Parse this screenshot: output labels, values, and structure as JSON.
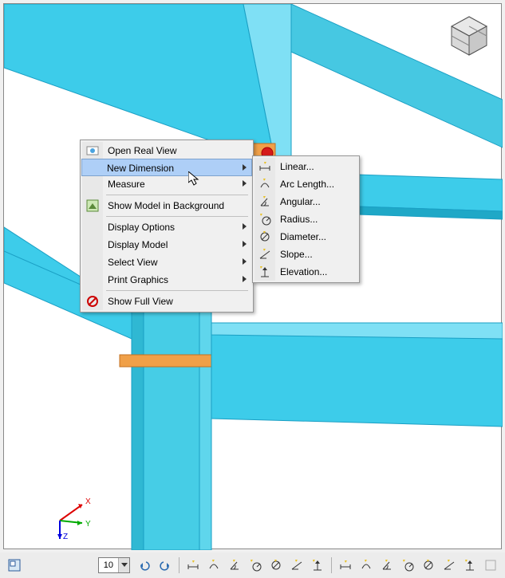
{
  "context_menu": {
    "items": [
      {
        "label": "Open Real View",
        "icon": "realview-icon",
        "has_submenu": false
      },
      {
        "label": "New Dimension",
        "icon": null,
        "has_submenu": true,
        "highlighted": true
      },
      {
        "label": "Measure",
        "icon": null,
        "has_submenu": true
      },
      {
        "sep": true
      },
      {
        "label": "Show Model in Background",
        "icon": "model-bg-icon",
        "has_submenu": false
      },
      {
        "sep": true
      },
      {
        "label": "Display Options",
        "icon": null,
        "has_submenu": true
      },
      {
        "label": "Display Model",
        "icon": null,
        "has_submenu": true
      },
      {
        "label": "Select View",
        "icon": null,
        "has_submenu": true
      },
      {
        "label": "Print Graphics",
        "icon": null,
        "has_submenu": true
      },
      {
        "sep": true
      },
      {
        "label": "Show Full View",
        "icon": "fullview-icon",
        "has_submenu": false
      }
    ]
  },
  "submenu": {
    "items": [
      {
        "label": "Linear...",
        "icon": "linear-icon"
      },
      {
        "label": "Arc Length...",
        "icon": "arc-icon"
      },
      {
        "label": "Angular...",
        "icon": "angular-icon"
      },
      {
        "label": "Radius...",
        "icon": "radius-icon"
      },
      {
        "label": "Diameter...",
        "icon": "diameter-icon"
      },
      {
        "label": "Slope...",
        "icon": "slope-icon"
      },
      {
        "label": "Elevation...",
        "icon": "elevation-icon"
      }
    ]
  },
  "toolbar": {
    "zoom_value": "10",
    "buttons_left": [
      "view-mode-toggle"
    ],
    "buttons_right": [
      "undo-icon",
      "redo-icon",
      "_sep",
      "linear-dim-icon",
      "arc-dim-icon",
      "angular-dim-icon",
      "radius-dim-icon",
      "diameter-dim-icon",
      "slope-dim-icon",
      "elevation-dim-icon",
      "_sep",
      "measure-linear-icon",
      "measure-arc-icon",
      "measure-angular-icon",
      "measure-radius-icon",
      "measure-diameter-icon",
      "measure-slope-icon",
      "measure-elevation-icon",
      "measure-blank-icon"
    ]
  },
  "axis": {
    "x": "X",
    "y": "Y",
    "z": "Z"
  },
  "colors": {
    "steel": "#3dccea",
    "steel_edge": "#1a9fc4",
    "plate": "#f0a048",
    "plate_edge": "#c27020",
    "bolt": "#d51b1b",
    "highlight": "#aecff7",
    "menu_bg": "#f0f0f0"
  }
}
